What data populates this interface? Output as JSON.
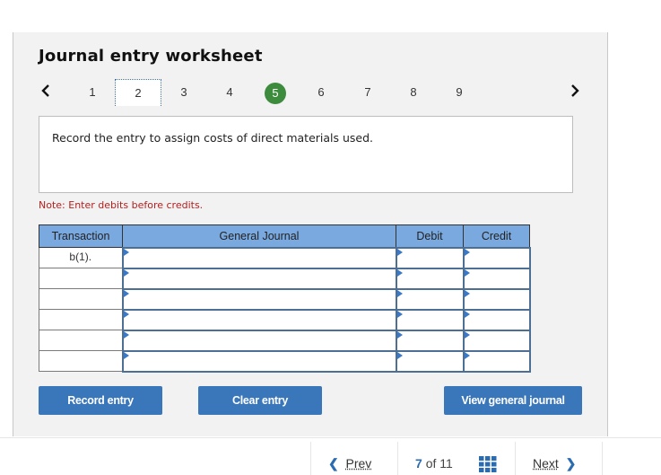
{
  "worksheet": {
    "title": "Journal entry worksheet",
    "pager": {
      "prev_icon": "chevron-left-icon",
      "next_icon": "chevron-right-icon",
      "pages": [
        "1",
        "2",
        "3",
        "4",
        "5",
        "6",
        "7",
        "8",
        "9"
      ],
      "focused_page": "2",
      "completed_page": "5"
    },
    "prompt": "Record the entry to assign costs of direct materials used.",
    "note": "Note: Enter debits before credits.",
    "table": {
      "headers": [
        "Transaction",
        "General Journal",
        "Debit",
        "Credit"
      ],
      "rows": [
        {
          "transaction": "b(1).",
          "account": "",
          "debit": "",
          "credit": ""
        },
        {
          "transaction": "",
          "account": "",
          "debit": "",
          "credit": ""
        },
        {
          "transaction": "",
          "account": "",
          "debit": "",
          "credit": ""
        },
        {
          "transaction": "",
          "account": "",
          "debit": "",
          "credit": ""
        },
        {
          "transaction": "",
          "account": "",
          "debit": "",
          "credit": ""
        },
        {
          "transaction": "",
          "account": "",
          "debit": "",
          "credit": ""
        }
      ]
    },
    "buttons": {
      "record": "Record entry",
      "clear": "Clear entry",
      "view": "View general journal"
    }
  },
  "footer": {
    "prev_label": "Prev",
    "next_label": "Next",
    "current": "7",
    "of_label": "of",
    "total": "11",
    "grid_icon": "grid-icon"
  },
  "colors": {
    "accent": "#3a76ba",
    "header_fill": "#7aa9e0",
    "completed": "#3d8b3d",
    "note": "#b22222"
  }
}
